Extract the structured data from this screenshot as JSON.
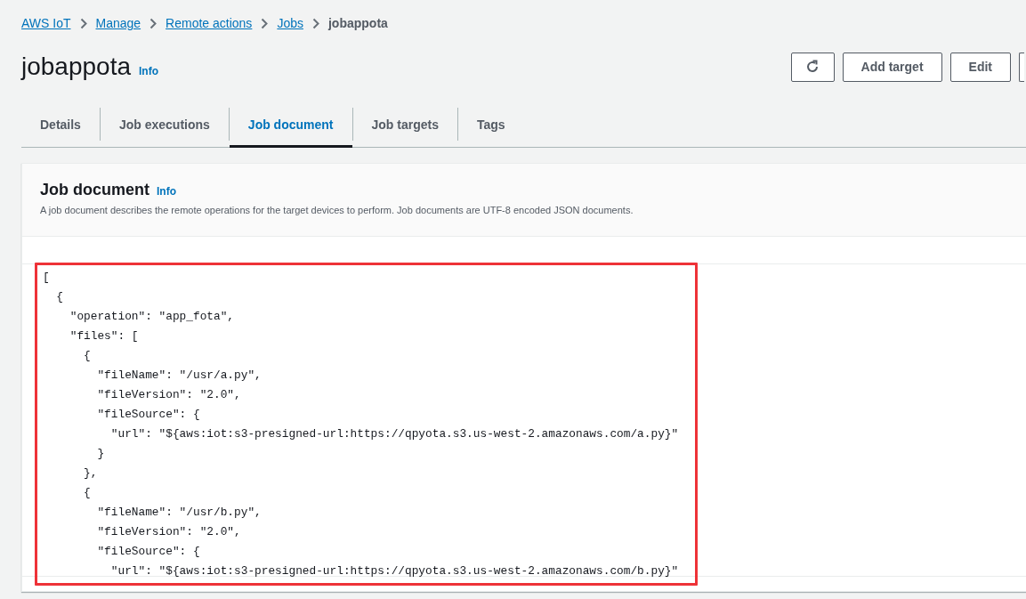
{
  "breadcrumbs": [
    {
      "label": "AWS IoT",
      "kind": "link"
    },
    {
      "label": "Manage",
      "kind": "link"
    },
    {
      "label": "Remote actions",
      "kind": "link"
    },
    {
      "label": "Jobs",
      "kind": "link"
    },
    {
      "label": "jobappota",
      "kind": "current"
    }
  ],
  "page_title": "jobappota",
  "title_info_link": "Info",
  "action_buttons": [
    {
      "kind": "refresh"
    },
    {
      "kind": "text",
      "label": "Add target"
    },
    {
      "kind": "text",
      "label": "Edit"
    },
    {
      "kind": "edge"
    }
  ],
  "tabs": [
    {
      "label": "Details",
      "selected": false
    },
    {
      "label": "Job executions",
      "selected": false
    },
    {
      "label": "Job document",
      "selected": true
    },
    {
      "label": "Job targets",
      "selected": false
    },
    {
      "label": "Tags",
      "selected": false
    }
  ],
  "panel": {
    "title": "Job document",
    "info_link": "Info",
    "description": "A job document describes the remote operations for the target devices to perform. Job documents are UTF-8 encoded JSON documents.",
    "code_lines": [
      "[",
      "  {",
      "    \"operation\": \"app_fota\",",
      "    \"files\": [",
      "      {",
      "        \"fileName\": \"/usr/a.py\",",
      "        \"fileVersion\": \"2.0\",",
      "        \"fileSource\": {",
      "          \"url\": \"${aws:iot:s3-presigned-url:https://qpyota.s3.us-west-2.amazonaws.com/a.py}\"",
      "        }",
      "      },",
      "      {",
      "        \"fileName\": \"/usr/b.py\",",
      "        \"fileVersion\": \"2.0\",",
      "        \"fileSource\": {",
      "          \"url\": \"${aws:iot:s3-presigned-url:https://qpyota.s3.us-west-2.amazonaws.com/b.py}\""
    ],
    "highlighted": true
  }
}
